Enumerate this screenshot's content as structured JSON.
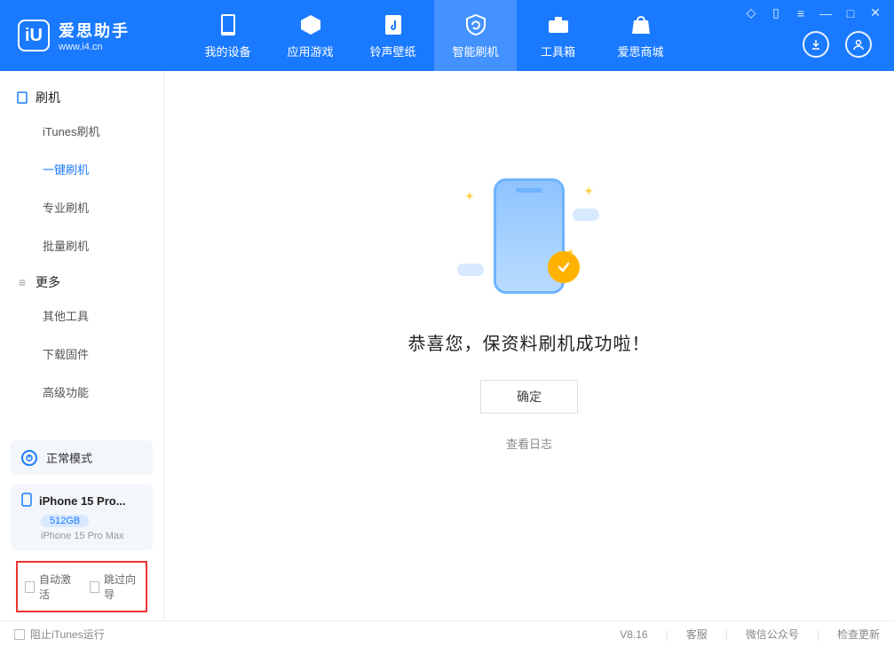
{
  "app": {
    "title": "爱思助手",
    "subtitle": "www.i4.cn"
  },
  "nav": {
    "items": [
      {
        "label": "我的设备"
      },
      {
        "label": "应用游戏"
      },
      {
        "label": "铃声壁纸"
      },
      {
        "label": "智能刷机"
      },
      {
        "label": "工具箱"
      },
      {
        "label": "爱思商城"
      }
    ],
    "active_index": 3
  },
  "sidebar": {
    "group1": {
      "title": "刷机",
      "items": [
        "iTunes刷机",
        "一键刷机",
        "专业刷机",
        "批量刷机"
      ],
      "active_index": 1
    },
    "group2": {
      "title": "更多",
      "items": [
        "其他工具",
        "下载固件",
        "高级功能"
      ]
    },
    "mode_label": "正常模式",
    "device": {
      "name": "iPhone 15 Pro...",
      "storage": "512GB",
      "model": "iPhone 15 Pro Max"
    },
    "checkboxes": {
      "auto_activate": "自动激活",
      "skip_guide": "跳过向导"
    }
  },
  "main": {
    "success_title": "恭喜您，保资料刷机成功啦！",
    "ok_button": "确定",
    "view_log": "查看日志"
  },
  "footer": {
    "block_itunes": "阻止iTunes运行",
    "version": "V8.16",
    "links": [
      "客服",
      "微信公众号",
      "检查更新"
    ]
  }
}
